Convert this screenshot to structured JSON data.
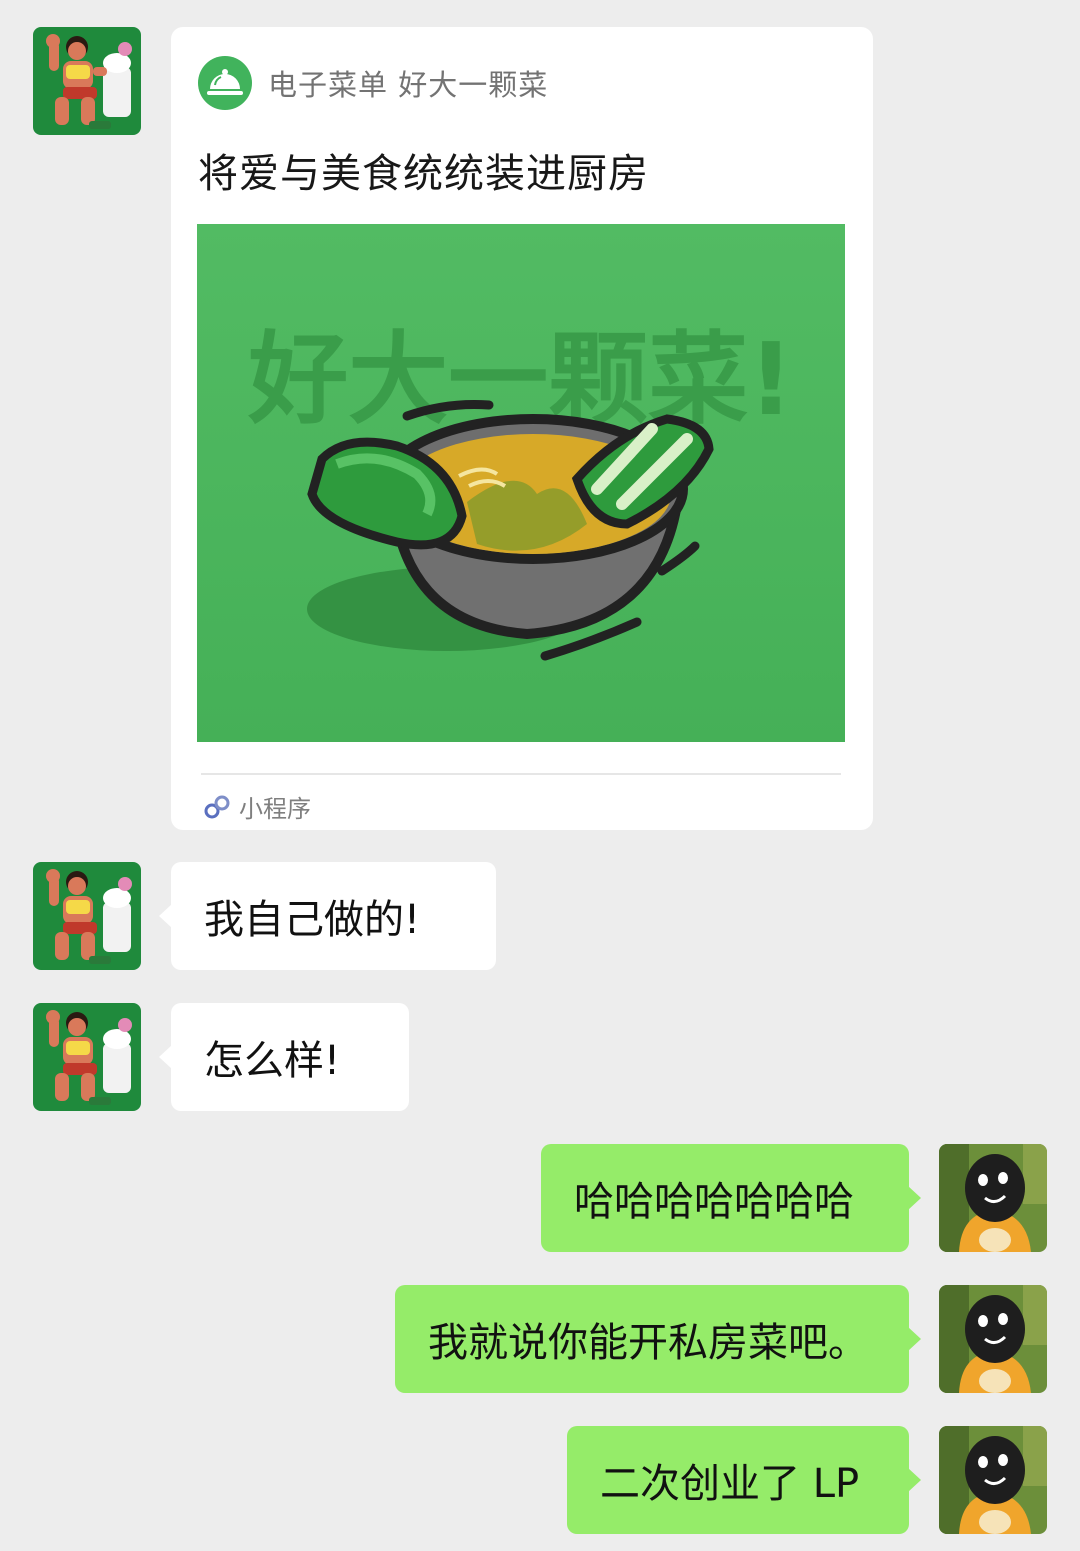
{
  "chat": {
    "mini_program": {
      "app_name": "电子菜单 好大一颗菜",
      "title": "将爱与美食统统装进厨房",
      "cover_text": "好大一颗菜!",
      "footer_label": "小程序",
      "brand_color": "#41b35c"
    },
    "messages": [
      {
        "side": "left",
        "text": "我自己做的!"
      },
      {
        "side": "left",
        "text": "怎么样!"
      },
      {
        "side": "right",
        "text": "哈哈哈哈哈哈哈"
      },
      {
        "side": "right",
        "text": "我就说你能开私房菜吧。"
      },
      {
        "side": "right",
        "text": "二次创业了 LP"
      }
    ],
    "colors": {
      "background": "#ededed",
      "incoming_bubble": "#ffffff",
      "outgoing_bubble": "#95ec69"
    },
    "avatars": {
      "contact": "cartoon-bodybuilder-avatar",
      "self": "black-creature-avatar"
    }
  }
}
